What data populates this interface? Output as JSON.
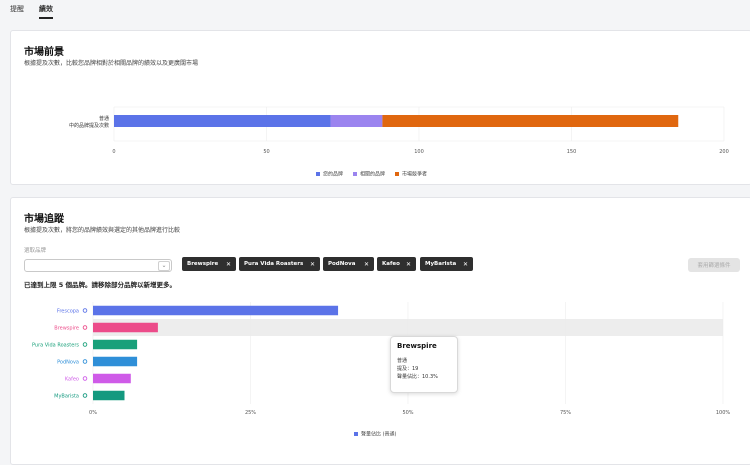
{
  "tabs": [
    {
      "label": "提醒"
    },
    {
      "label": "績效"
    }
  ],
  "market_outlook": {
    "title": "市場前景",
    "subtitle": "根據提及次數，比較您品牌相對於相關品牌的績效以及更廣闊市場",
    "y_label_line1": "普通",
    "y_label_line2": "中的品牌提及次數",
    "legend": [
      {
        "label": "您的品牌",
        "color": "#5b73e8"
      },
      {
        "label": "相關的品牌",
        "color": "#9b84ef"
      },
      {
        "label": "市場競爭者",
        "color": "#e0670f"
      }
    ]
  },
  "market_tracking": {
    "title": "市場追蹤",
    "subtitle": "根據提及次數，將您的品牌績效與選定的其他品牌進行比較",
    "dropdown_label": "選取品牌",
    "dropdown_value": "",
    "chips": [
      {
        "label": "Brewspire"
      },
      {
        "label": "Pura Vida Roasters"
      },
      {
        "label": "PodNova"
      },
      {
        "label": "Kafeo"
      },
      {
        "label": "MyBarista"
      }
    ],
    "compare_button": "套用篩選條件",
    "limit_message": "已達到上限 5 個品牌。請移除部分品牌以新增更多。",
    "legend_label": "聲量佔比 (普通)",
    "legend_color": "#5b73e8",
    "tooltip": {
      "title": "Brewspire",
      "category": "普通",
      "mentions": "提及：19",
      "share": "聲量佔比：10.3%"
    }
  },
  "chart_data": [
    {
      "type": "bar",
      "orientation": "horizontal",
      "stacked": true,
      "categories": [
        "普通中的品牌提及次數"
      ],
      "series": [
        {
          "name": "您的品牌",
          "values": [
            71
          ],
          "color": "#5b73e8"
        },
        {
          "name": "相關的品牌",
          "values": [
            17
          ],
          "color": "#9b84ef"
        },
        {
          "name": "市場競爭者",
          "values": [
            97
          ],
          "color": "#e0670f"
        }
      ],
      "xlim": [
        0,
        200
      ],
      "xticks": [
        "0",
        "50",
        "100",
        "150",
        "200"
      ],
      "grid": true,
      "legend": "bottom"
    },
    {
      "type": "bar",
      "orientation": "horizontal",
      "categories": [
        "Frescopa",
        "Brewspire",
        "Pura Vida Roasters",
        "PodNova",
        "Kafeo",
        "MyBarista"
      ],
      "category_colors": [
        "#5b73e8",
        "#ec4c8a",
        "#19a07a",
        "#2f8fd8",
        "#cf5be8",
        "#14997f"
      ],
      "series": [
        {
          "name": "聲量佔比 (普通)",
          "values": [
            38.9,
            10.3,
            7.0,
            7.0,
            6.0,
            5.0
          ]
        }
      ],
      "xlim": [
        0,
        100
      ],
      "xticks": [
        "0%",
        "25%",
        "50%",
        "75%",
        "100%"
      ],
      "highlighted_category": "Brewspire",
      "grid": true,
      "legend": "bottom"
    }
  ]
}
